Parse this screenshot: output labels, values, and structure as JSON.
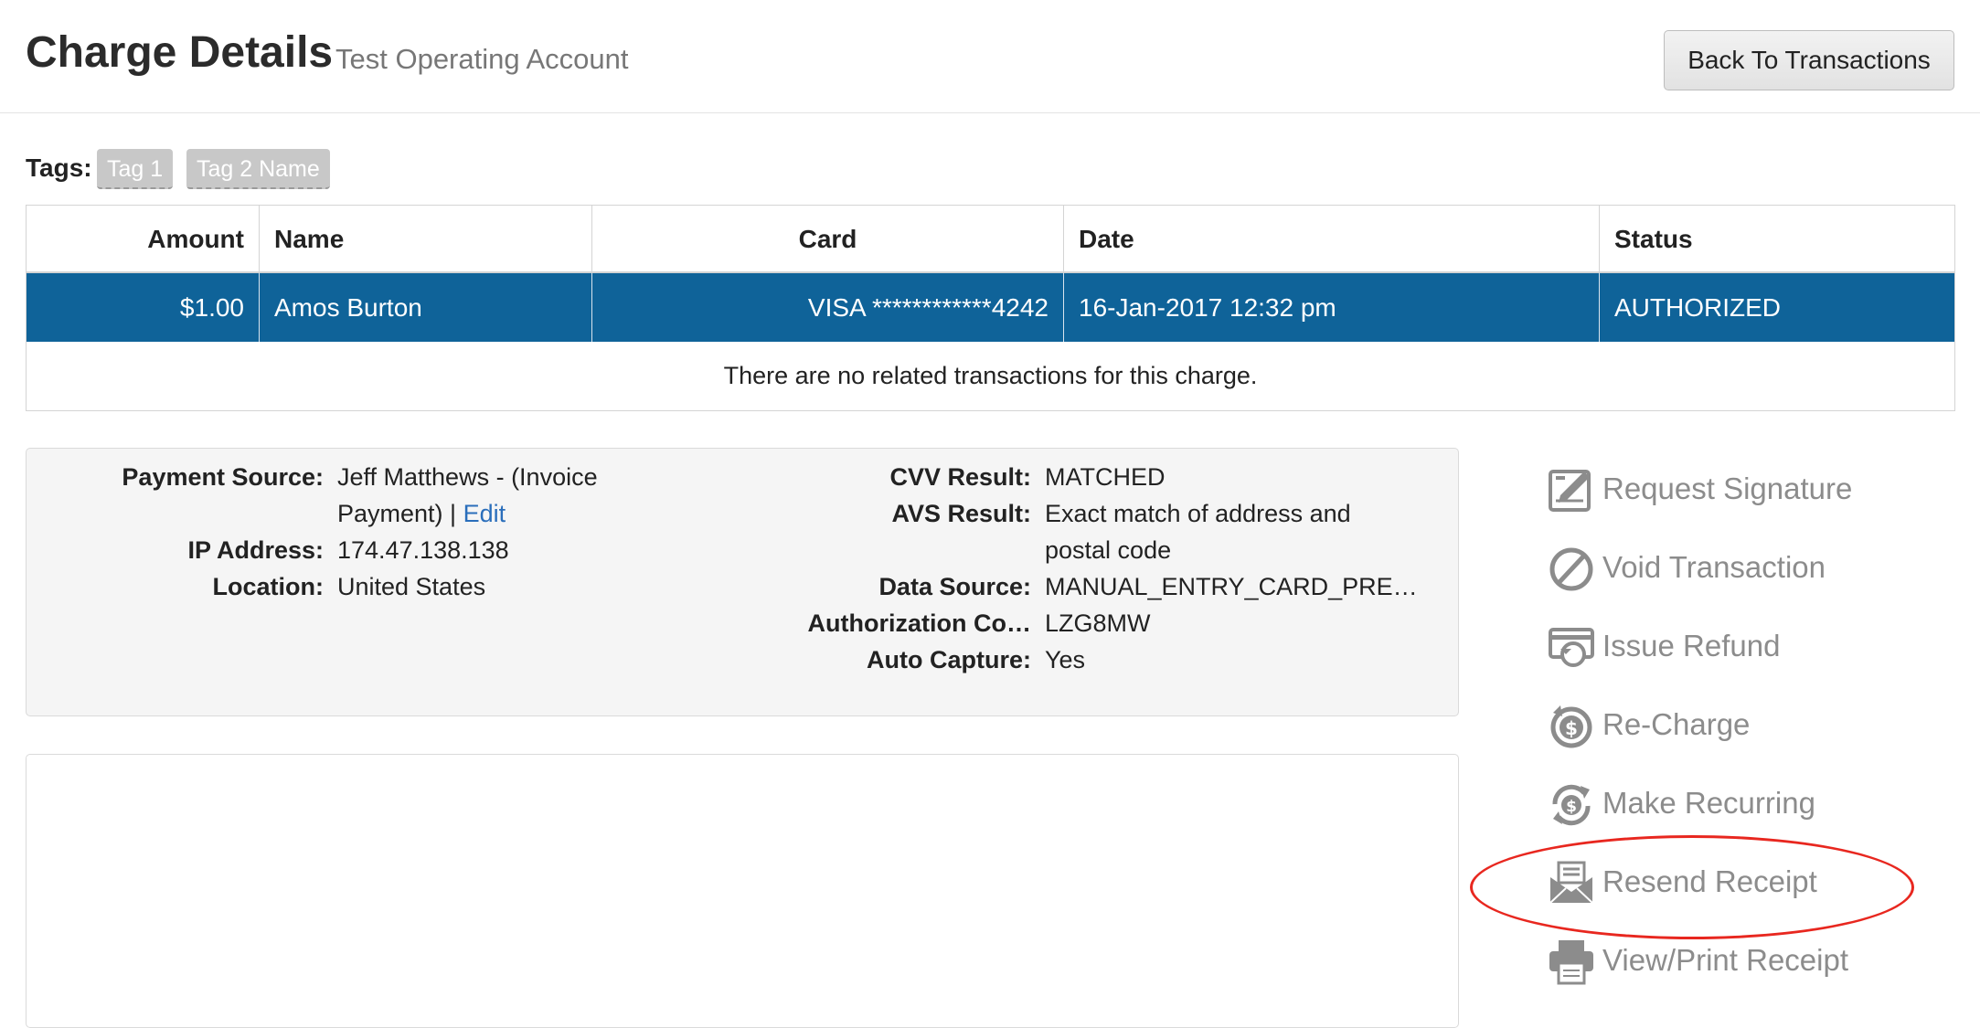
{
  "header": {
    "title": "Charge Details",
    "subtitle": "Test Operating Account",
    "back_button": "Back To Transactions"
  },
  "tags": {
    "label": "Tags:",
    "items": [
      "Tag 1",
      "Tag 2 Name"
    ]
  },
  "table": {
    "columns": [
      "Amount",
      "Name",
      "Card",
      "Date",
      "Status"
    ],
    "rows": [
      {
        "amount": "$1.00",
        "name": "Amos Burton",
        "card": "VISA ************4242",
        "date": "16-Jan-2017 12:32 pm",
        "status": "AUTHORIZED"
      }
    ],
    "note": "There are no related transactions for this charge."
  },
  "details": {
    "payment_source_label": "Payment Source:",
    "payment_source_line1": "Jeff Matthews - (Invoice",
    "payment_source_line2": "Payment) |",
    "edit_link": "Edit",
    "ip_label": "IP Address:",
    "ip_value": "174.47.138.138",
    "location_label": "Location:",
    "location_value": "United States",
    "cvv_label": "CVV Result:",
    "cvv_value": "MATCHED",
    "avs_label": "AVS Result:",
    "avs_value_line1": "Exact match of address and",
    "avs_value_line2": "postal code",
    "data_source_label": "Data Source:",
    "data_source_value": "MANUAL_ENTRY_CARD_PRE…",
    "auth_code_label": "Authorization Co…",
    "auth_code_value": "LZG8MW",
    "auto_capture_label": "Auto Capture:",
    "auto_capture_value": "Yes"
  },
  "actions": [
    {
      "label": "Request Signature",
      "icon": "signature-icon"
    },
    {
      "label": "Void Transaction",
      "icon": "void-icon"
    },
    {
      "label": "Issue Refund",
      "icon": "refund-icon"
    },
    {
      "label": "Re-Charge",
      "icon": "recharge-icon"
    },
    {
      "label": "Make Recurring",
      "icon": "recurring-icon"
    },
    {
      "label": "Resend Receipt",
      "icon": "envelope-icon"
    },
    {
      "label": "View/Print Receipt",
      "icon": "printer-icon"
    }
  ],
  "colors": {
    "selected_row": "#0f6399",
    "link": "#2a6ebb",
    "action_gray": "#8c8c8c",
    "highlight": "#e8271f"
  }
}
